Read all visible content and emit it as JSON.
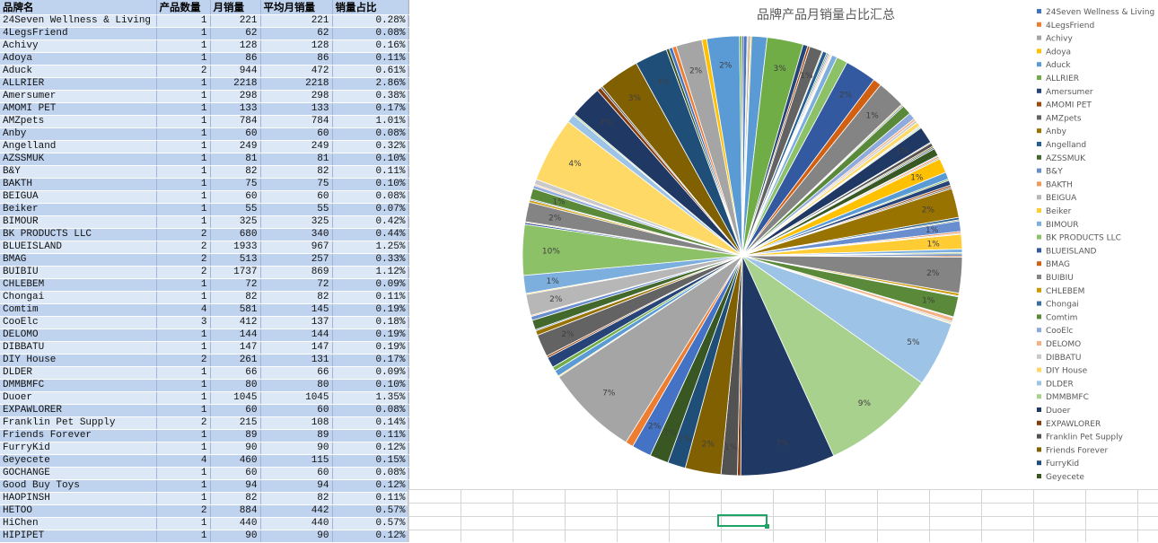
{
  "table": {
    "headers": [
      "品牌名",
      "产品数量",
      "月销量",
      "平均月销量",
      "销量占比"
    ],
    "rows": [
      [
        "24Seven Wellness & Living",
        "1",
        "221",
        "221",
        "0.28%"
      ],
      [
        "4LegsFriend",
        "1",
        "62",
        "62",
        "0.08%"
      ],
      [
        "Achivy",
        "1",
        "128",
        "128",
        "0.16%"
      ],
      [
        "Adoya",
        "1",
        "86",
        "86",
        "0.11%"
      ],
      [
        "Aduck",
        "2",
        "944",
        "472",
        "0.61%"
      ],
      [
        "ALLRIER",
        "1",
        "2218",
        "2218",
        "2.86%"
      ],
      [
        "Amersumer",
        "1",
        "298",
        "298",
        "0.38%"
      ],
      [
        "AMOMI PET",
        "1",
        "133",
        "133",
        "0.17%"
      ],
      [
        "AMZpets",
        "1",
        "784",
        "784",
        "1.01%"
      ],
      [
        "Anby",
        "1",
        "60",
        "60",
        "0.08%"
      ],
      [
        "Angelland",
        "1",
        "249",
        "249",
        "0.32%"
      ],
      [
        "AZSSMUK",
        "1",
        "81",
        "81",
        "0.10%"
      ],
      [
        "B&Y",
        "1",
        "82",
        "82",
        "0.11%"
      ],
      [
        "BAKTH",
        "1",
        "75",
        "75",
        "0.10%"
      ],
      [
        "BEIGUA",
        "1",
        "60",
        "60",
        "0.08%"
      ],
      [
        "Beiker",
        "1",
        "55",
        "55",
        "0.07%"
      ],
      [
        "BIMOUR",
        "1",
        "325",
        "325",
        "0.42%"
      ],
      [
        "BK PRODUCTS LLC",
        "2",
        "680",
        "340",
        "0.44%"
      ],
      [
        "BLUEISLAND",
        "2",
        "1933",
        "967",
        "1.25%"
      ],
      [
        "BMAG",
        "2",
        "513",
        "257",
        "0.33%"
      ],
      [
        "BUIBIU",
        "2",
        "1737",
        "869",
        "1.12%"
      ],
      [
        "CHLEBEM",
        "1",
        "72",
        "72",
        "0.09%"
      ],
      [
        "Chongai",
        "1",
        "82",
        "82",
        "0.11%"
      ],
      [
        "Comtim",
        "4",
        "581",
        "145",
        "0.19%"
      ],
      [
        "CooElc",
        "3",
        "412",
        "137",
        "0.18%"
      ],
      [
        "DELOMO",
        "1",
        "144",
        "144",
        "0.19%"
      ],
      [
        "DIBBATU",
        "1",
        "147",
        "147",
        "0.19%"
      ],
      [
        "DIY House",
        "2",
        "261",
        "131",
        "0.17%"
      ],
      [
        "DLDER",
        "1",
        "66",
        "66",
        "0.09%"
      ],
      [
        "DMMBMFC",
        "1",
        "80",
        "80",
        "0.10%"
      ],
      [
        "Duoer",
        "1",
        "1045",
        "1045",
        "1.35%"
      ],
      [
        "EXPAWLORER",
        "1",
        "60",
        "60",
        "0.08%"
      ],
      [
        "Franklin Pet Supply",
        "2",
        "215",
        "108",
        "0.14%"
      ],
      [
        "Friends Forever",
        "1",
        "89",
        "89",
        "0.11%"
      ],
      [
        "FurryKid",
        "1",
        "90",
        "90",
        "0.12%"
      ],
      [
        "Geyecete",
        "4",
        "460",
        "115",
        "0.15%"
      ],
      [
        "GOCHANGE",
        "1",
        "60",
        "60",
        "0.08%"
      ],
      [
        "Good Buy Toys",
        "1",
        "94",
        "94",
        "0.12%"
      ],
      [
        "HAOPINSH",
        "1",
        "82",
        "82",
        "0.11%"
      ],
      [
        "HETOO",
        "2",
        "884",
        "442",
        "0.57%"
      ],
      [
        "HiChen",
        "1",
        "440",
        "440",
        "0.57%"
      ],
      [
        "HIPIPET",
        "1",
        "90",
        "90",
        "0.12%"
      ]
    ]
  },
  "chart_data": {
    "type": "pie",
    "title": "品牌产品月销量占比汇总",
    "legend_position": "right",
    "legend": [
      "24Seven Wellness & Living",
      "4LegsFriend",
      "Achivy",
      "Adoya",
      "Aduck",
      "ALLRIER",
      "Amersumer",
      "AMOMI PET",
      "AMZpets",
      "Anby",
      "Angelland",
      "AZSSMUK",
      "B&Y",
      "BAKTH",
      "BEIGUA",
      "Beiker",
      "BIMOUR",
      "BK PRODUCTS LLC",
      "BLUEISLAND",
      "BMAG",
      "BUIBIU",
      "CHLEBEM",
      "Chongai",
      "Comtim",
      "CooElc",
      "DELOMO",
      "DIBBATU",
      "DIY House",
      "DLDER",
      "DMMBMFC",
      "Duoer",
      "EXPAWLORER",
      "Franklin Pet Supply",
      "Friends Forever",
      "FurryKid",
      "Geyecete"
    ],
    "palette": [
      "#4472c4",
      "#ed7d31",
      "#a5a5a5",
      "#ffc000",
      "#5b9bd5",
      "#70ad47",
      "#264478",
      "#9e480e",
      "#636363",
      "#997300",
      "#255e91",
      "#43682b",
      "#698ed0",
      "#f1975a",
      "#b7b7b7",
      "#ffcd33",
      "#7cafdd",
      "#8cc168",
      "#335aa1",
      "#d26012",
      "#848484",
      "#cc9a00",
      "#3a6fa1",
      "#5a8a39",
      "#8faadc",
      "#f4b183",
      "#c9c9c9",
      "#ffd966",
      "#9dc3e6",
      "#a9d18e",
      "#1f3864",
      "#843c0c",
      "#525252",
      "#806000",
      "#1f4e79",
      "#385723"
    ],
    "values": [
      221,
      62,
      128,
      86,
      944,
      2218,
      298,
      133,
      784,
      60,
      249,
      81,
      82,
      75,
      60,
      55,
      325,
      680,
      1933,
      513,
      1737,
      72,
      82,
      581,
      412,
      144,
      147,
      261,
      66,
      80,
      1045,
      60,
      215,
      89,
      90,
      460,
      60,
      94,
      82,
      884,
      440,
      90,
      300,
      120,
      95,
      1800,
      150,
      70,
      640,
      110,
      65,
      900,
      210,
      85,
      120,
      75,
      2200,
      160,
      60,
      1250,
      55,
      230,
      95,
      70,
      4000,
      7000,
      5800,
      200,
      1000,
      2200,
      1100,
      1150,
      1200,
      480,
      5700,
      70,
      380,
      250,
      650,
      120,
      1380,
      280,
      75,
      600,
      240,
      65,
      1300,
      70,
      1100,
      3100,
      110,
      60,
      1200,
      140,
      70,
      650,
      200,
      80,
      310,
      4000,
      500,
      100,
      2000,
      250,
      120,
      2500,
      2000,
      180,
      210,
      240,
      1600,
      300,
      2000,
      150,
      90
    ],
    "labels": [
      "",
      "",
      "",
      "",
      "",
      "3%",
      "",
      "",
      "1%",
      "",
      "",
      "",
      "",
      "",
      "",
      "",
      "",
      "",
      "2%",
      "",
      "1%",
      "",
      "",
      "",
      "",
      "",
      "",
      "",
      "",
      "",
      "1%",
      "",
      "",
      "",
      "",
      "",
      "",
      "",
      "",
      "1%",
      "",
      "",
      "",
      "",
      "",
      "2%",
      "",
      "",
      "1%",
      "",
      "",
      "1%",
      "",
      "",
      "",
      "",
      "2%",
      "",
      "",
      "1%",
      "",
      "",
      "",
      "",
      "5%",
      "9%",
      "7%",
      "",
      "1%",
      "2%",
      "1%",
      "1%",
      "2%",
      "",
      "7%",
      "",
      "",
      "",
      "",
      "",
      "2%",
      "",
      "",
      "",
      "",
      "",
      "2%",
      "",
      "1%",
      "10%",
      "",
      "",
      "2%",
      "",
      "",
      "1%",
      "",
      "",
      "",
      "4%",
      "",
      "",
      "2%",
      "",
      "",
      "3%",
      "3%",
      "",
      "",
      "",
      "2%",
      "",
      "2%",
      "",
      ""
    ]
  }
}
